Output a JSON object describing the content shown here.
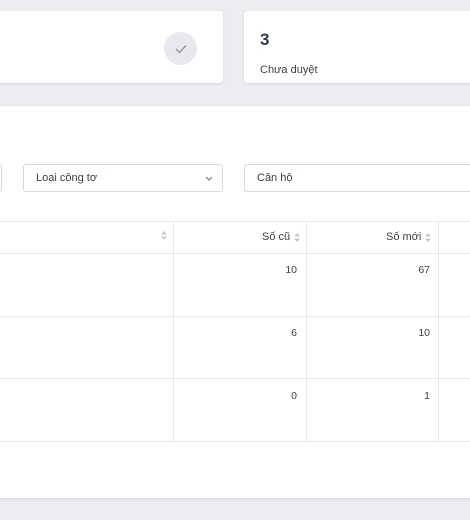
{
  "stats": {
    "unapproved_value": "3",
    "unapproved_label": "Chưa duyệt"
  },
  "filters": {
    "meter_type_placeholder": "Loại công tơ",
    "apartment_placeholder": "Căn hộ"
  },
  "table": {
    "columns": [
      "Số cũ",
      "Số mới"
    ],
    "rows": [
      {
        "old": "10",
        "new": "67"
      },
      {
        "old": "6",
        "new": "10"
      },
      {
        "old": "0",
        "new": "1"
      }
    ]
  }
}
